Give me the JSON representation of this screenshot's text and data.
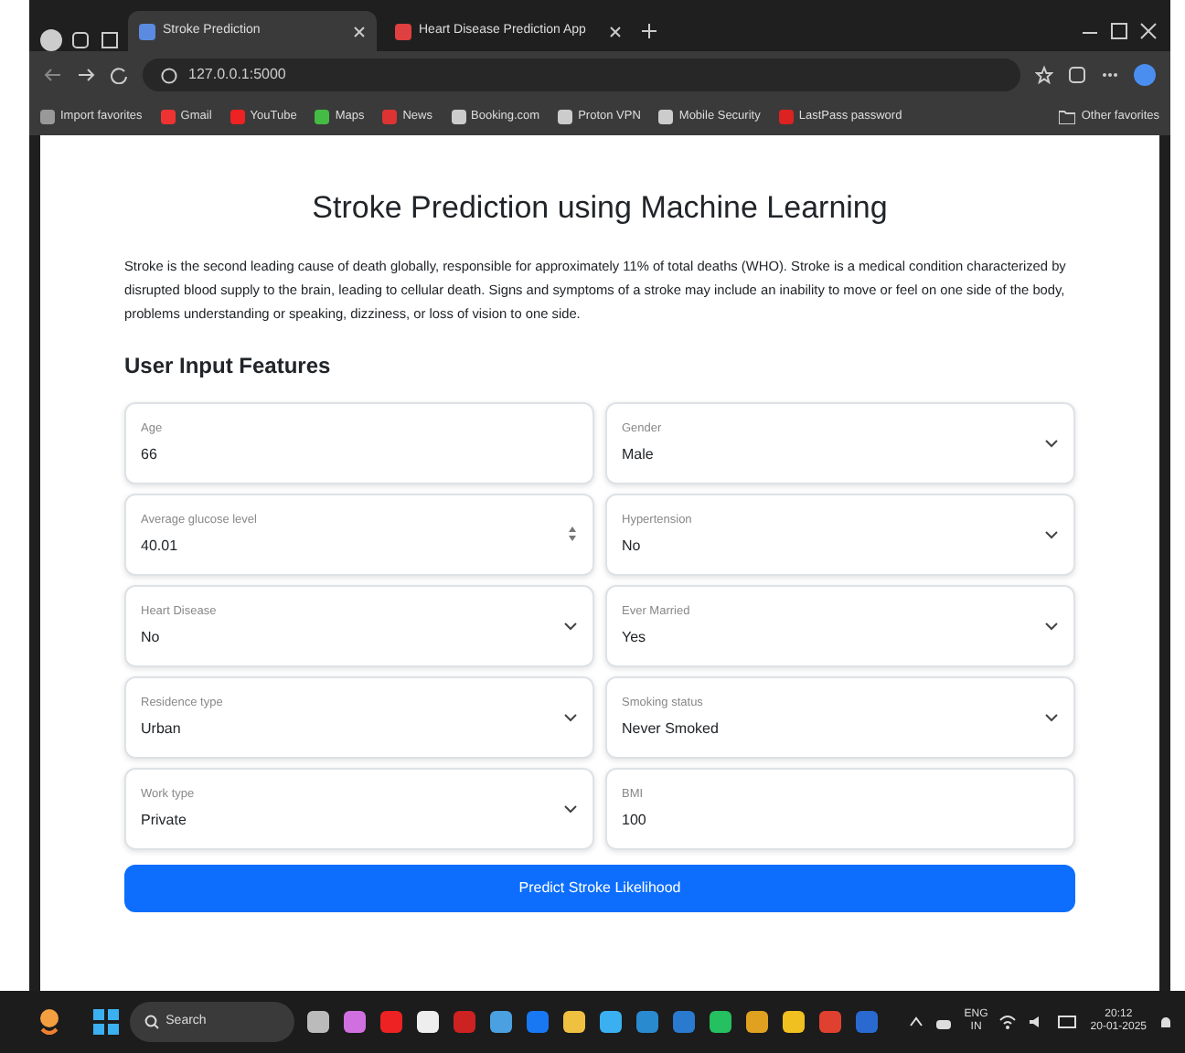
{
  "browser": {
    "tabs": [
      {
        "title": "Stroke Prediction",
        "selected": true
      },
      {
        "title": "Heart Disease Prediction App",
        "selected": false
      }
    ],
    "address": "127.0.0.1:5000",
    "bookmarks": [
      "Import favorites",
      "Gmail",
      "YouTube",
      "Maps",
      "News",
      "Booking.com",
      "Proton VPN",
      "Mobile Security",
      "LastPass password"
    ],
    "other_bookmarks": "Other favorites"
  },
  "page": {
    "title": "Stroke Prediction using Machine Learning",
    "intro": "Stroke is the second leading cause of death globally, responsible for approximately 11% of total deaths (WHO). Stroke is a medical condition characterized by disrupted blood supply to the brain, leading to cellular death. Signs and symptoms of a stroke may include an inability to move or feel on one side of the body, problems understanding or speaking, dizziness, or loss of vision to one side.",
    "section_title": "User Input Features",
    "fields": [
      {
        "kind": "input",
        "label": "Age",
        "value": "66"
      },
      {
        "kind": "select",
        "label": "Gender",
        "value": "Male"
      },
      {
        "kind": "number",
        "label": "Average glucose level",
        "value": "40.01"
      },
      {
        "kind": "select",
        "label": "Hypertension",
        "value": "No"
      },
      {
        "kind": "select",
        "label": "Heart Disease",
        "value": "No"
      },
      {
        "kind": "select",
        "label": "Ever Married",
        "value": "Yes"
      },
      {
        "kind": "select",
        "label": "Residence type",
        "value": "Urban"
      },
      {
        "kind": "select",
        "label": "Smoking status",
        "value": "Never Smoked"
      },
      {
        "kind": "select",
        "label": "Work type",
        "value": "Private"
      },
      {
        "kind": "input",
        "label": "BMI",
        "value": "100"
      }
    ],
    "submit": "Predict Stroke Likelihood"
  },
  "taskbar": {
    "search": "Search",
    "tray": [
      "ENG",
      "IN"
    ],
    "time": "20:12",
    "date": "20-01-2025"
  }
}
